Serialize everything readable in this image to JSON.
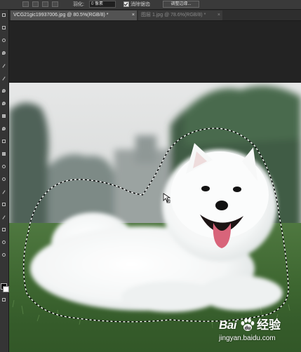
{
  "options_bar": {
    "feather_label": "羽化:",
    "feather_value": "0 像素",
    "antialias_label": "消除锯齿",
    "antialias_checked": true,
    "refine_edge_label": "调整边缘..."
  },
  "tabs": [
    {
      "label": "VCG21gic19937006.jpg @ 80.5%(RGB/8) *",
      "close": "×",
      "active": true
    },
    {
      "label": "图层 1.jpg @ 78.6%(RGB/8) *",
      "close": "×",
      "active": false
    }
  ],
  "tools": [
    "move-tool-icon",
    "marquee-tool-icon",
    "lasso-tool-icon",
    "quick-select-tool-icon",
    "crop-tool-icon",
    "eyedropper-tool-icon",
    "healing-brush-tool-icon",
    "brush-tool-icon",
    "clone-stamp-tool-icon",
    "history-brush-tool-icon",
    "eraser-tool-icon",
    "gradient-tool-icon",
    "blur-tool-icon",
    "dodge-tool-icon",
    "pen-tool-icon",
    "type-tool-icon",
    "path-select-tool-icon",
    "shape-tool-icon",
    "hand-tool-icon",
    "zoom-tool-icon"
  ],
  "colors": {
    "foreground": "#000000",
    "background": "#ffffff",
    "ui_dark": "#282828",
    "ui_panel": "#353535",
    "selection_marching_ants": "#ffffff"
  },
  "canvas": {
    "image_subject": "white-samoyed-dog-on-grass",
    "active_tool_cursor": "lasso-cursor-icon"
  },
  "watermark": {
    "brand_left": "Bai",
    "brand_right": "经验",
    "url": "jingyan.baidu.com"
  }
}
